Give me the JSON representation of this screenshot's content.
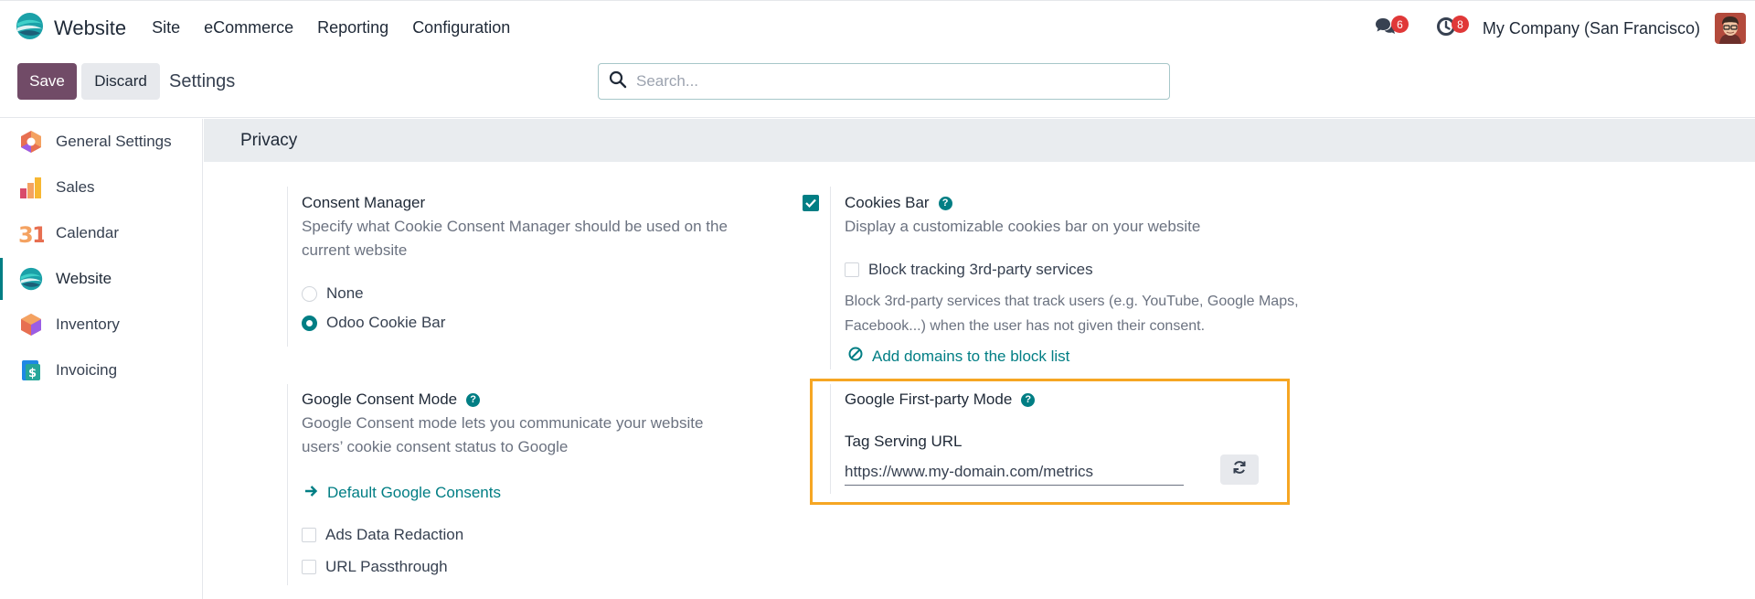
{
  "navbar": {
    "app_name": "Website",
    "menu": [
      {
        "label": "Site"
      },
      {
        "label": "eCommerce"
      },
      {
        "label": "Reporting"
      },
      {
        "label": "Configuration"
      }
    ],
    "messages_count": "6",
    "activities_count": "8",
    "company": "My Company (San Francisco)"
  },
  "control": {
    "save_label": "Save",
    "discard_label": "Discard",
    "title": "Settings",
    "search_placeholder": "Search..."
  },
  "sidebar": {
    "items": [
      {
        "label": "General Settings",
        "icon": "general-settings-icon"
      },
      {
        "label": "Sales",
        "icon": "sales-icon"
      },
      {
        "label": "Calendar",
        "icon": "calendar-icon"
      },
      {
        "label": "Website",
        "icon": "website-icon",
        "active": true
      },
      {
        "label": "Inventory",
        "icon": "inventory-icon"
      },
      {
        "label": "Invoicing",
        "icon": "invoicing-icon"
      }
    ]
  },
  "section": {
    "title": "Privacy"
  },
  "consent_manager": {
    "title": "Consent Manager",
    "desc_line1": "Specify what Cookie Consent Manager should be used on the",
    "desc_line2": "current website",
    "options": [
      {
        "label": "None",
        "selected": false
      },
      {
        "label": "Odoo Cookie Bar",
        "selected": true
      }
    ]
  },
  "cookies_bar": {
    "title": "Cookies Bar",
    "checked": true,
    "desc": "Display a customizable cookies bar on your website",
    "block_tracking_label": "Block tracking 3rd-party services",
    "block_tracking_checked": false,
    "block_desc_line1": "Block 3rd-party services that track users (e.g. YouTube, Google Maps,",
    "block_desc_line2": "Facebook...) when the user has not given their consent.",
    "add_domains_link": "Add domains to the block list"
  },
  "google_consent": {
    "title": "Google Consent Mode",
    "desc_line1": "Google Consent mode lets you communicate your website",
    "desc_line2": "users’ cookie consent status to Google",
    "default_link": "Default Google Consents",
    "ads_redaction_label": "Ads Data Redaction",
    "ads_redaction_checked": false,
    "url_passthrough_label": "URL Passthrough",
    "url_passthrough_checked": false
  },
  "google_first_party": {
    "title": "Google First-party Mode",
    "tag_url_label": "Tag Serving URL",
    "tag_url_value": "https://www.my-domain.com/metrics"
  },
  "colors": {
    "primary": "#714b67",
    "accent": "#017e84",
    "highlight": "#f6a623",
    "badge": "#e03838"
  }
}
